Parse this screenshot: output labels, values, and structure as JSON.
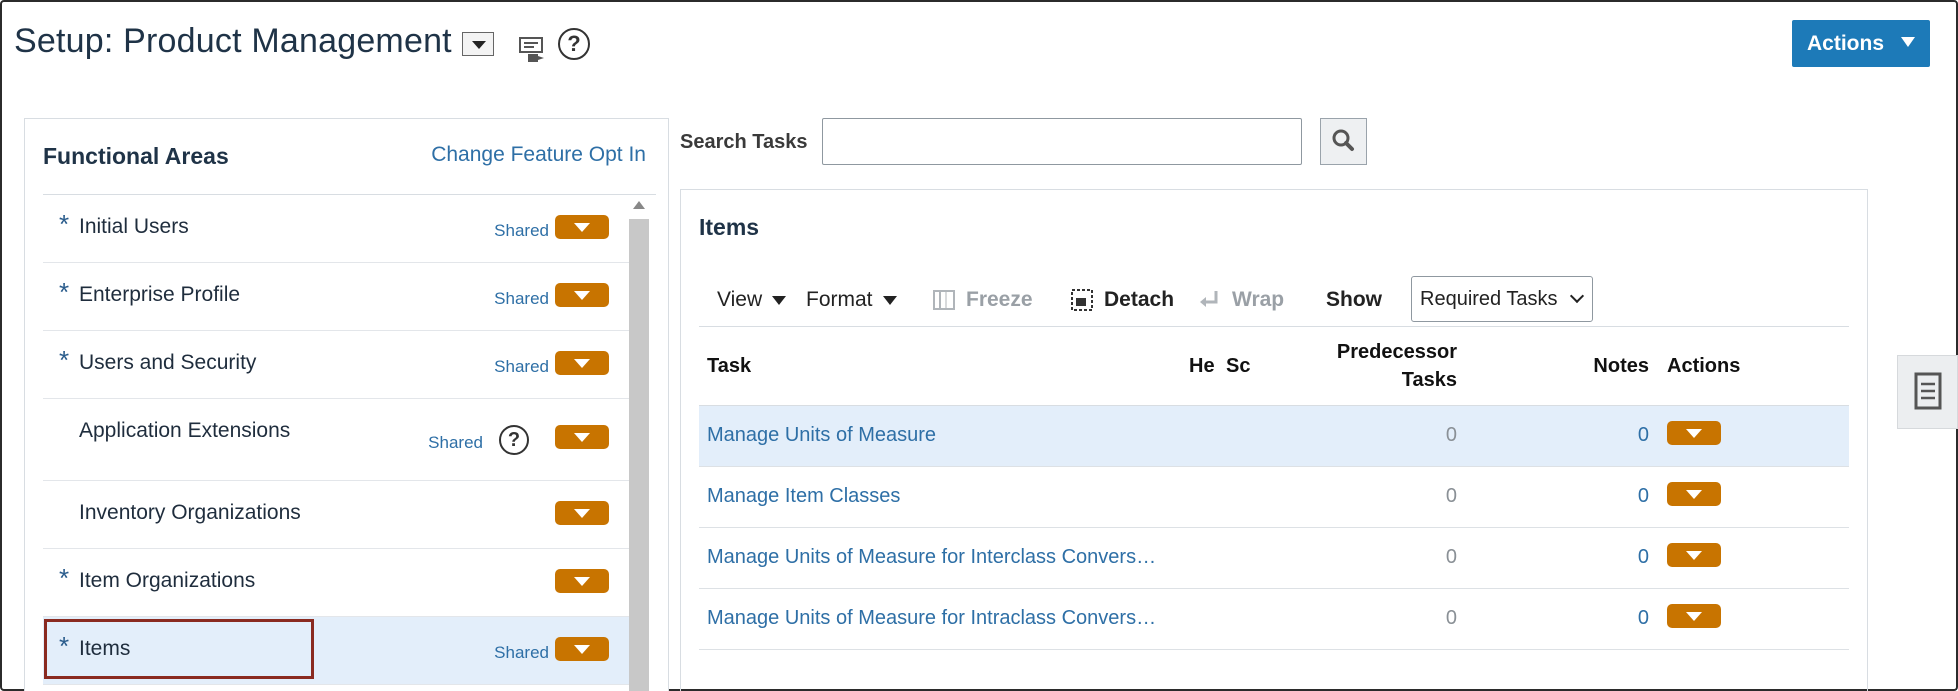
{
  "header": {
    "title": "Setup: Product Management",
    "help_glyph": "?",
    "actions_label": "Actions"
  },
  "functional_areas": {
    "title": "Functional Areas",
    "change_link": "Change Feature Opt In",
    "items": [
      {
        "label": "Initial Users",
        "required": "*",
        "status": "Shared"
      },
      {
        "label": "Enterprise Profile",
        "required": "*",
        "status": "Shared"
      },
      {
        "label": "Users and Security",
        "required": "*",
        "status": "Shared"
      },
      {
        "label": "Application Extensions",
        "required": "",
        "status": "Shared",
        "help": "?"
      },
      {
        "label": "Inventory Organizations",
        "required": "",
        "status": ""
      },
      {
        "label": "Item Organizations",
        "required": "*",
        "status": ""
      },
      {
        "label": "Items",
        "required": "*",
        "status": "Shared",
        "selected": true
      }
    ]
  },
  "search": {
    "label": "Search Tasks",
    "value": "",
    "placeholder": ""
  },
  "items_panel": {
    "title": "Items",
    "toolbar": {
      "view": "View",
      "format": "Format",
      "freeze": "Freeze",
      "detach": "Detach",
      "wrap": "Wrap",
      "show_label": "Show",
      "show_value": "Required Tasks"
    },
    "columns": {
      "task": "Task",
      "he": "He",
      "sc": "Sc",
      "predecessor_line1": "Predecessor",
      "predecessor_line2": "Tasks",
      "notes": "Notes",
      "actions": "Actions"
    },
    "rows": [
      {
        "task": "Manage Units of Measure",
        "predecessor": "0",
        "notes": "0"
      },
      {
        "task": "Manage Item Classes",
        "predecessor": "0",
        "notes": "0"
      },
      {
        "task": "Manage Units of Measure for Interclass Convers…",
        "predecessor": "0",
        "notes": "0"
      },
      {
        "task": "Manage Units of Measure for Intraclass Convers…",
        "predecessor": "0",
        "notes": "0"
      }
    ]
  },
  "colors": {
    "accent_blue": "#1d7ab8",
    "link_blue": "#2e6fa6",
    "orange": "#c87400",
    "selected_row": "#e3eefa",
    "highlight_box": "#8a2a20"
  }
}
